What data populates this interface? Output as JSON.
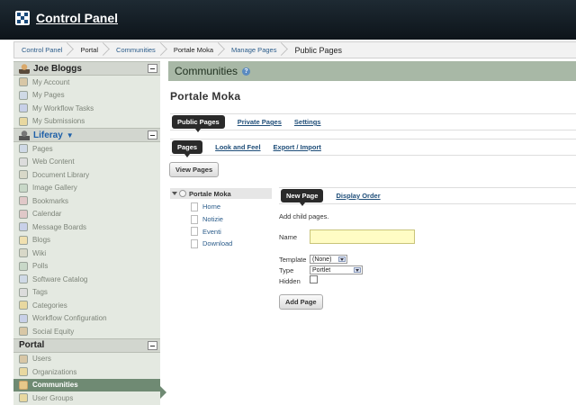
{
  "header": {
    "title": "Control Panel"
  },
  "breadcrumb": [
    "Control Panel",
    "Portal",
    "Communities",
    "Portale Moka",
    "Manage Pages",
    "Public Pages"
  ],
  "sidebar": {
    "user_section": {
      "title": "Joe Bloggs",
      "items": [
        "My Account",
        "My Pages",
        "My Workflow Tasks",
        "My Submissions"
      ]
    },
    "liferay_section": {
      "title": "Liferay",
      "items": [
        "Pages",
        "Web Content",
        "Document Library",
        "Image Gallery",
        "Bookmarks",
        "Calendar",
        "Message Boards",
        "Blogs",
        "Wiki",
        "Polls",
        "Software Catalog",
        "Tags",
        "Categories",
        "Workflow Configuration",
        "Social Equity"
      ]
    },
    "portal_section": {
      "title": "Portal",
      "items": [
        "Users",
        "Organizations",
        "Communities",
        "User Groups"
      ],
      "active": "Communities"
    }
  },
  "main": {
    "section_title": "Communities",
    "help_glyph": "?",
    "portal_title": "Portale Moka",
    "tabs": [
      "Public Pages",
      "Private Pages",
      "Settings"
    ],
    "subtabs": [
      "Pages",
      "Look and Feel",
      "Export / Import"
    ],
    "view_pages_button": "View Pages",
    "tree": {
      "root": "Portale Moka",
      "children": [
        "Home",
        "Notizie",
        "Eventi",
        "Download"
      ]
    },
    "page_tabs": [
      "New Page",
      "Display Order"
    ],
    "add_child_text": "Add child pages.",
    "form": {
      "name_label": "Name",
      "name_value": "",
      "template_label": "Template",
      "template_value": "(None)",
      "type_label": "Type",
      "type_value": "Portlet",
      "hidden_label": "Hidden",
      "hidden_checked": false,
      "add_button": "Add Page"
    }
  }
}
